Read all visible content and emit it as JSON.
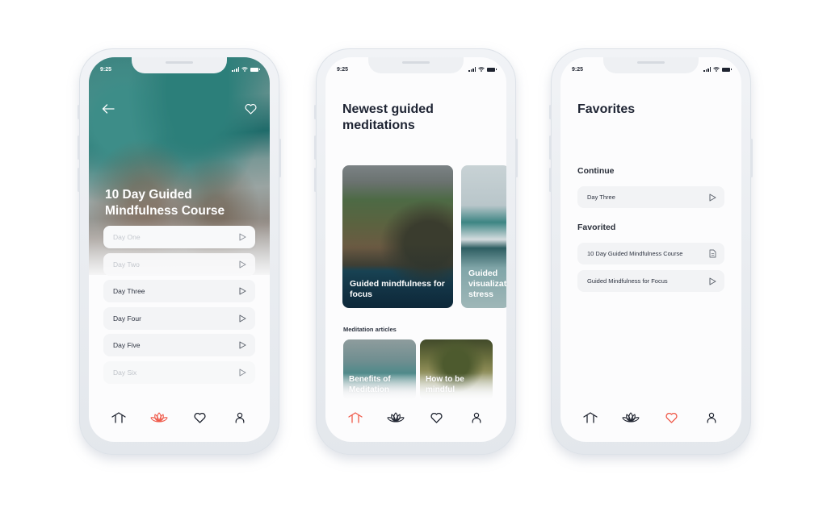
{
  "accent_color": "#ef5a4a",
  "phones": [
    {
      "status": {
        "time": "9:25"
      },
      "header": {
        "title": "10 Day Guided Mindfulness Course"
      },
      "days": [
        {
          "label": "Day One",
          "state": "faded"
        },
        {
          "label": "Day Two",
          "state": "faded"
        },
        {
          "label": "Day Three",
          "state": "normal"
        },
        {
          "label": "Day Four",
          "state": "normal"
        },
        {
          "label": "Day Five",
          "state": "normal"
        },
        {
          "label": "Day Six",
          "state": "faded"
        }
      ],
      "tabbar": {
        "active": "meditate"
      }
    },
    {
      "status": {
        "time": "9:25"
      },
      "title": "Newest guided meditations",
      "cards": [
        {
          "label": "Guided mindfulness for focus"
        },
        {
          "label": "Guided visualization stress"
        }
      ],
      "articles_label": "Meditation articles",
      "articles": [
        {
          "label": "Benefits of Meditation"
        },
        {
          "label": "How to be mindful"
        }
      ],
      "tabbar": {
        "active": "home"
      }
    },
    {
      "status": {
        "time": "9:25"
      },
      "title": "Favorites",
      "continue_label": "Continue",
      "continue_items": [
        {
          "label": "Day Three",
          "icon": "play-icon"
        }
      ],
      "favorited_label": "Favorited",
      "favorited_items": [
        {
          "label": "10 Day Guided Mindfulness Course",
          "icon": "document-icon"
        },
        {
          "label": "Guided Mindfulness for Focus",
          "icon": "play-icon"
        }
      ],
      "tabbar": {
        "active": "favorites"
      }
    }
  ],
  "tabbar_items": [
    "home",
    "meditate",
    "favorites",
    "profile"
  ]
}
